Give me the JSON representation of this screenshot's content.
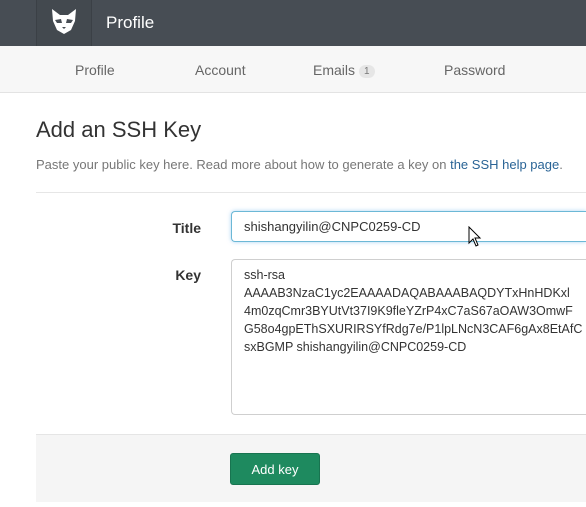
{
  "header": {
    "title": "Profile",
    "logo_icon": "cat-logo-icon"
  },
  "subnav": {
    "items": [
      {
        "label": "Profile"
      },
      {
        "label": "Account"
      },
      {
        "label": "Emails",
        "badge": "1"
      },
      {
        "label": "Password"
      }
    ]
  },
  "page": {
    "heading": "Add an SSH Key",
    "help_prefix": "Paste your public key here. Read more about how to generate a key on ",
    "help_link": "the SSH help page",
    "help_suffix": "."
  },
  "form": {
    "title_label": "Title",
    "title_value": "shishangyilin@CNPC0259-CD",
    "key_label": "Key",
    "key_value": "ssh-rsa\nAAAAB3NzaC1yc2EAAAADAQABAAABAQDYTxHnHDKxl\n4m0zqCmr3BYUtVt37I9K9fleYZrP4xC7aS67aOAW3OmwF\nG58o4gpEThSXURIRSYfRdg7e/P1lpLNcN3CAF6gAx8EtAfC\nsxBGMP shishangyilin@CNPC0259-CD",
    "submit_label": "Add key"
  },
  "colors": {
    "topbar": "#474d54",
    "submit_button": "#1e8a5f",
    "link": "#2a6496"
  }
}
